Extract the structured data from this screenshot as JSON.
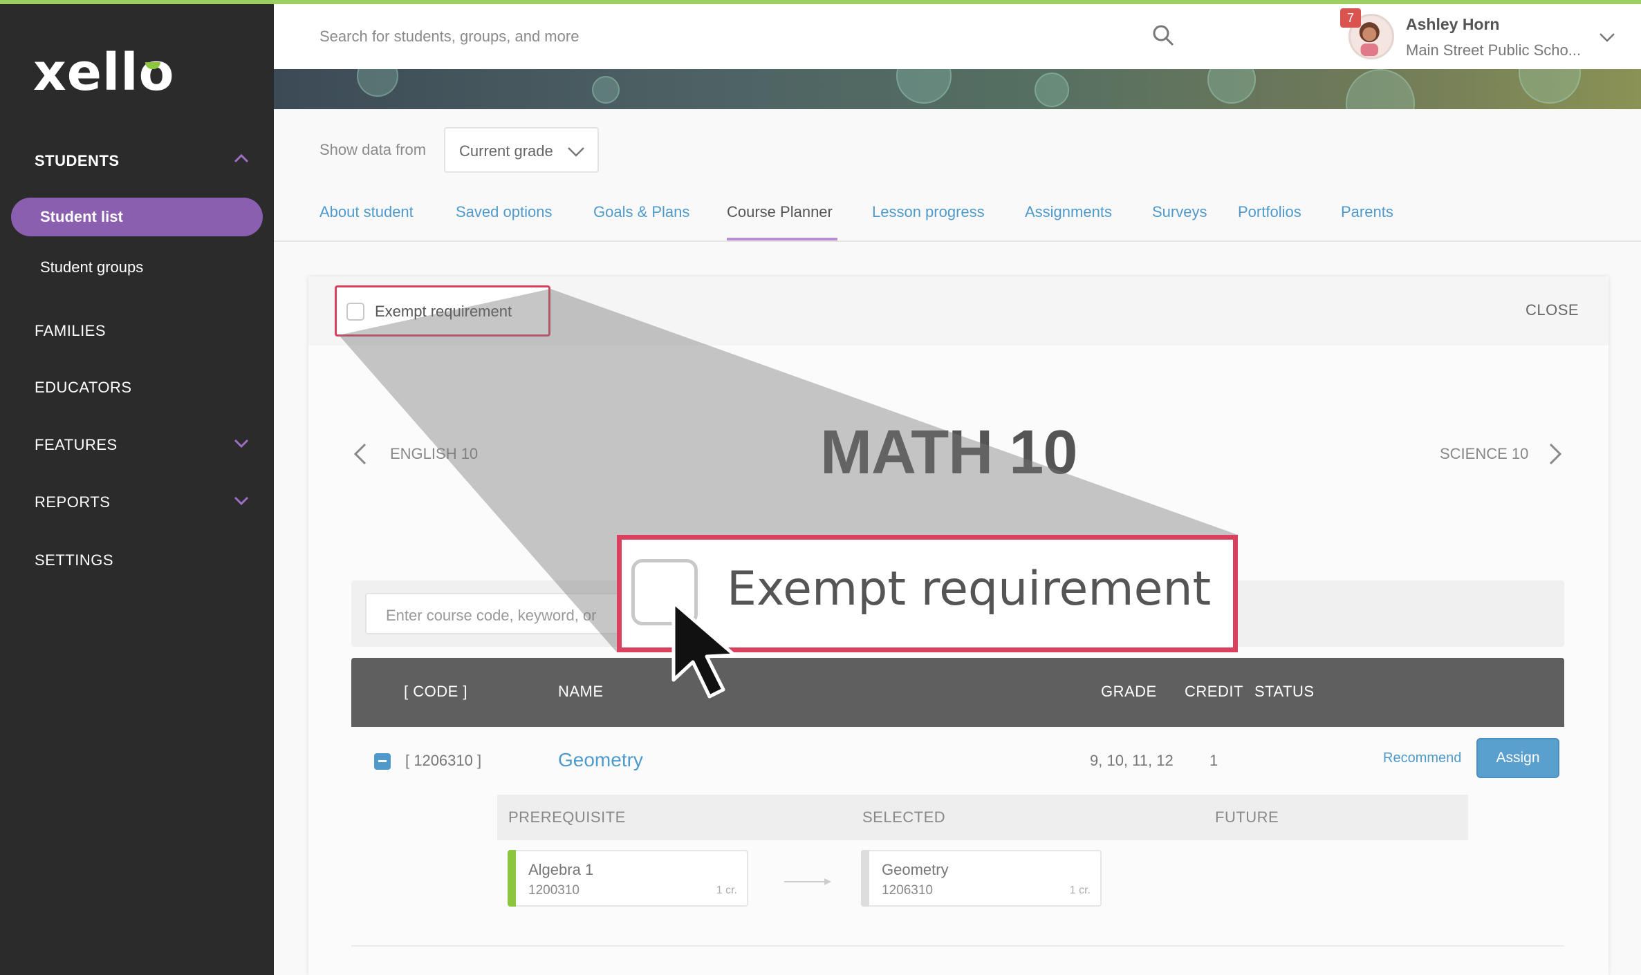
{
  "app": {
    "logo": "xello"
  },
  "sidebar": {
    "students": "STUDENTS",
    "student_list": "Student list",
    "student_groups": "Student groups",
    "families": "FAMILIES",
    "educators": "EDUCATORS",
    "features": "FEATURES",
    "reports": "REPORTS",
    "settings": "SETTINGS"
  },
  "header": {
    "search_placeholder": "Search for students, groups, and more",
    "notification_count": "7",
    "user_name": "Ashley Horn",
    "user_school": "Main Street Public Scho..."
  },
  "filter": {
    "label": "Show data from",
    "value": "Current grade"
  },
  "tabs": [
    {
      "label": "About student"
    },
    {
      "label": "Saved options"
    },
    {
      "label": "Goals & Plans"
    },
    {
      "label": "Course Planner"
    },
    {
      "label": "Lesson progress"
    },
    {
      "label": "Assignments"
    },
    {
      "label": "Surveys"
    },
    {
      "label": "Portfolios"
    },
    {
      "label": "Parents"
    }
  ],
  "modal": {
    "exempt_label": "Exempt requirement",
    "close_label": "CLOSE",
    "prev_course": "ENGLISH 10",
    "current_course": "MATH 10",
    "next_course": "SCIENCE 10",
    "course_search_placeholder": "Enter course code, keyword, or"
  },
  "table": {
    "headers": {
      "code": "[ CODE ]",
      "name": "NAME",
      "grade": "GRADE",
      "credit": "CREDIT",
      "status": "STATUS"
    },
    "row": {
      "code": "[ 1206310 ]",
      "name": "Geometry",
      "grade": "9, 10, 11, 12",
      "credit": "1",
      "recommend": "Recommend",
      "assign": "Assign"
    },
    "prereq_headers": {
      "prerequisite": "PREREQUISITE",
      "selected": "SELECTED",
      "future": "FUTURE"
    },
    "prereq_card": {
      "name": "Algebra 1",
      "code": "1200310",
      "credit": "1 cr."
    },
    "selected_card": {
      "name": "Geometry",
      "code": "1206310",
      "credit": "1 cr."
    }
  },
  "zoom": {
    "label": "Exempt requirement"
  },
  "colors": {
    "accent_purple": "#8b5fb0",
    "link_blue": "#4f9acb",
    "highlight_red": "#d9415f",
    "sidebar_bg": "#2b2b2b",
    "prereq_green": "#8cc63f"
  },
  "icons": [
    "search-icon",
    "chevron-up-icon",
    "chevron-down-icon",
    "chevron-left-icon",
    "chevron-right-icon",
    "minus-icon",
    "arrow-right-icon",
    "cursor-icon"
  ]
}
